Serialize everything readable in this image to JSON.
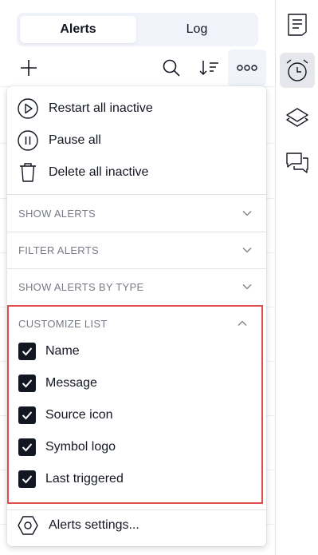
{
  "tabs": [
    {
      "label": "Alerts",
      "active": true
    },
    {
      "label": "Log",
      "active": false
    }
  ],
  "toolbar": {
    "icons": [
      "add-icon",
      "search-icon",
      "sort-icon",
      "more-icon"
    ]
  },
  "menu": {
    "actions": [
      {
        "label": "Restart all inactive",
        "icon": "play-circle-icon"
      },
      {
        "label": "Pause all",
        "icon": "pause-circle-icon"
      },
      {
        "label": "Delete all inactive",
        "icon": "trash-icon"
      }
    ],
    "sections": [
      {
        "label": "SHOW ALERTS",
        "expanded": false
      },
      {
        "label": "FILTER ALERTS",
        "expanded": false
      },
      {
        "label": "SHOW ALERTS BY TYPE",
        "expanded": false
      }
    ],
    "customize": {
      "label": "CUSTOMIZE LIST",
      "expanded": true,
      "options": [
        {
          "label": "Name",
          "checked": true
        },
        {
          "label": "Message",
          "checked": true
        },
        {
          "label": "Source icon",
          "checked": true
        },
        {
          "label": "Symbol logo",
          "checked": true
        },
        {
          "label": "Last triggered",
          "checked": true
        }
      ]
    },
    "settings": {
      "label": "Alerts settings...",
      "icon": "hexagon-settings-icon"
    }
  },
  "right_sidebar": {
    "icons": [
      "notes-icon",
      "alarm-clock-icon",
      "layers-icon",
      "chat-icon"
    ],
    "active": "alarm-clock-icon"
  },
  "colors": {
    "highlight_border": "#e04b4b",
    "text": "#131722",
    "muted": "#787b86",
    "tab_bg": "#f0f3fa"
  }
}
